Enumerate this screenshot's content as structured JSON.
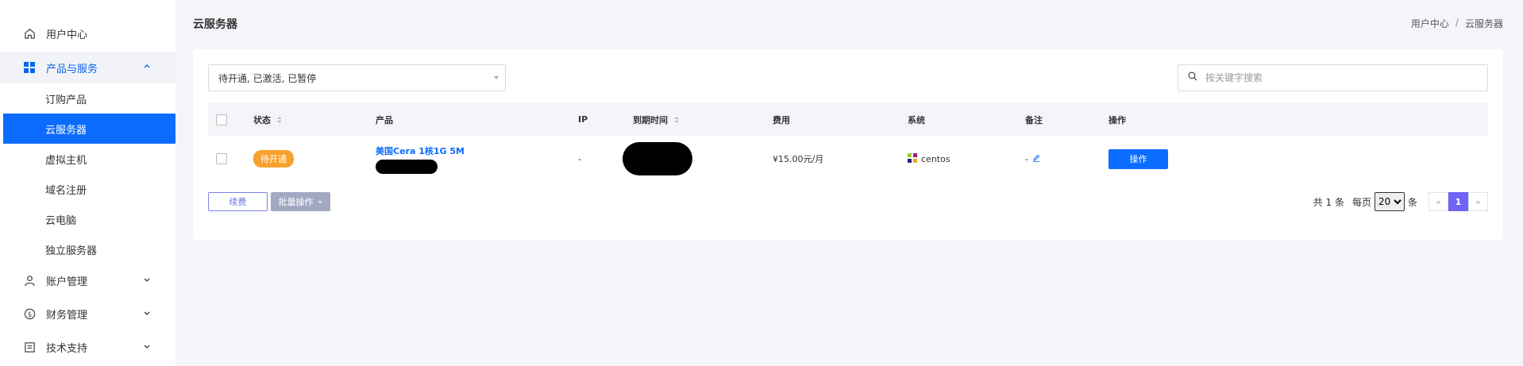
{
  "sidebar": {
    "user_center": "用户中心",
    "products": "产品与服务",
    "sub_items": [
      "订购产品",
      "云服务器",
      "虚拟主机",
      "域名注册",
      "云电脑",
      "独立服务器"
    ],
    "account": "账户管理",
    "finance": "财务管理",
    "support": "技术支持"
  },
  "header": {
    "title": "云服务器",
    "breadcrumb": [
      "用户中心",
      "云服务器"
    ],
    "breadcrumb_sep": "/"
  },
  "filter": {
    "value": "待开通, 已激活, 已暂停"
  },
  "search": {
    "placeholder": "按关键字搜索"
  },
  "table": {
    "headers": {
      "status": "状态",
      "product": "产品",
      "ip": "IP",
      "expire": "到期时间",
      "fee": "费用",
      "system": "系统",
      "note": "备注",
      "action": "操作"
    },
    "row": {
      "status": "待开通",
      "product": "美国Cera 1核1G 5M",
      "ip": "-",
      "fee": "¥15.00元/月",
      "system": "centos",
      "note": "-",
      "action": "操作"
    }
  },
  "footer": {
    "renew": "续费",
    "batch": "批量操作",
    "total": "共 1 条",
    "per_page_label": "每页",
    "per_page": "20",
    "per_page_suffix": "条",
    "prev": "«",
    "current_page": "1",
    "next": "»"
  },
  "colors": {
    "primary": "#0b6cff",
    "status_pending": "#f7a22e",
    "pager_active": "#6f63f6"
  }
}
